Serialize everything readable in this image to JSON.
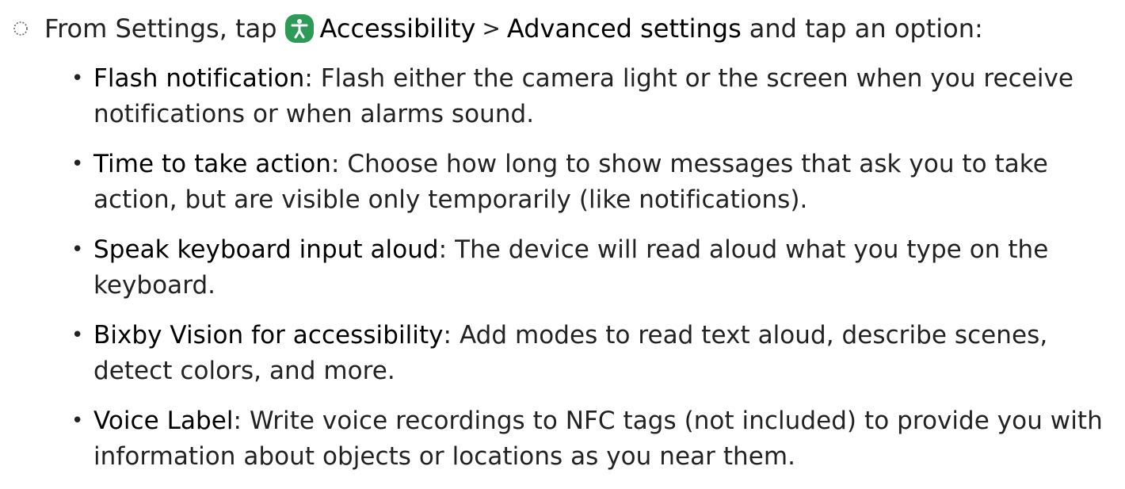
{
  "step": {
    "marker_icon": "step-circle-icon",
    "intro": "From Settings, tap",
    "icon_name": "accessibility-icon",
    "icon_color": "#2e9a58",
    "menu_item": "Accessibility",
    "separator": ">",
    "submenu": "Advanced settings",
    "outro": "and tap an option:"
  },
  "options": [
    {
      "term": "Flash notification",
      "description": "Flash either the camera light or the screen when you receive notifications or when alarms sound."
    },
    {
      "term": "Time to take action",
      "description": "Choose how long to show messages that ask you to take action, but are visible only temporarily (like notifications)."
    },
    {
      "term": "Speak keyboard input aloud",
      "description": "The device will read aloud what you type on the keyboard."
    },
    {
      "term": "Bixby Vision for accessibility",
      "description": "Add modes to read text aloud, describe scenes, detect colors, and more."
    },
    {
      "term": "Voice Label",
      "description": "Write voice recordings to NFC tags (not included) to provide you with information about objects or locations as you near them."
    }
  ],
  "bullet": "•"
}
